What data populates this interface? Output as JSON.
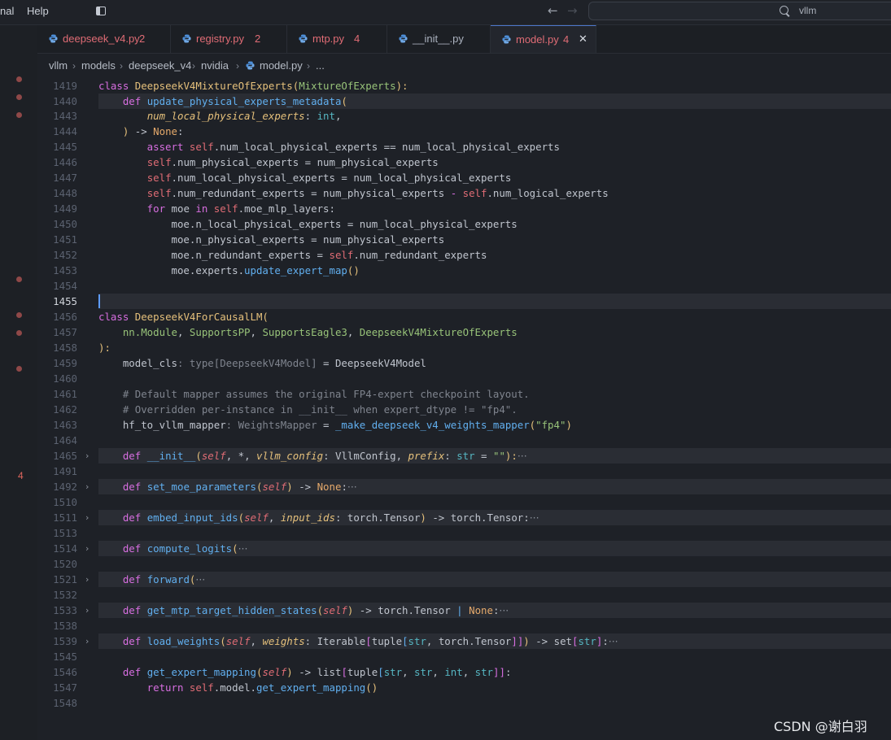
{
  "titlebar": {
    "menu": [
      "nal",
      "Help"
    ],
    "search_text": "vllm"
  },
  "tabs": [
    {
      "label": "deepseek_v4.py",
      "badge": "2",
      "color": "#e06c75"
    },
    {
      "label": "registry.py",
      "badge": "2",
      "color": "#e06c75"
    },
    {
      "label": "mtp.py",
      "badge": "4",
      "color": "#e06c75"
    },
    {
      "label": "__init__.py",
      "badge": "",
      "color": "#abb2bf"
    },
    {
      "label": "model.py",
      "badge": "4",
      "color": "#e06c75",
      "active": true
    }
  ],
  "breadcrumb": [
    "vllm",
    "models",
    "deepseek_v4",
    "nvidia",
    "model.py",
    "..."
  ],
  "editor": {
    "gutter_badge": "4",
    "line_numbers": [
      "1419",
      "1440",
      "1443",
      "1444",
      "1445",
      "1446",
      "1447",
      "1448",
      "1449",
      "1450",
      "1451",
      "1452",
      "1453",
      "1454",
      "1455",
      "1456",
      "1457",
      "1458",
      "1459",
      "1460",
      "1461",
      "1462",
      "1463",
      "1464",
      "1465",
      "1491",
      "1492",
      "1510",
      "1511",
      "1513",
      "1514",
      "1520",
      "1521",
      "1532",
      "1533",
      "1538",
      "1539",
      "1545",
      "1546",
      "1547",
      "1548"
    ],
    "current_line": "1455"
  },
  "code": {
    "l1419": [
      "class ",
      "DeepseekV4MixtureOfExperts",
      "(",
      "MixtureOfExperts",
      "):"
    ],
    "l1440": [
      "    def ",
      "update_physical_experts_metadata",
      "("
    ],
    "l1443": [
      "        ",
      "num_local_physical_experts",
      ": ",
      "int",
      ","
    ],
    "l1444": [
      "    ",
      ")",
      " -> ",
      "None",
      ":"
    ],
    "l1445": [
      "        assert ",
      "self",
      ".num_local_physical_experts == num_local_physical_experts"
    ],
    "l1446": [
      "        ",
      "self",
      ".num_physical_experts = num_physical_experts"
    ],
    "l1447": [
      "        ",
      "self",
      ".num_local_physical_experts = num_local_physical_experts"
    ],
    "l1448": [
      "        ",
      "self",
      ".num_redundant_experts = num_physical_experts ",
      "-",
      " ",
      "self",
      ".num_logical_experts"
    ],
    "l1449": [
      "        for ",
      "moe ",
      "in ",
      "self",
      ".moe_mlp_layers:"
    ],
    "l1450": [
      "            moe.n_local_physical_experts = num_local_physical_experts"
    ],
    "l1451": [
      "            moe.n_physical_experts = num_physical_experts"
    ],
    "l1452": [
      "            moe.n_redundant_experts = ",
      "self",
      ".num_redundant_experts"
    ],
    "l1453": [
      "            moe.experts.",
      "update_expert_map",
      "()"
    ],
    "l1456": [
      "class ",
      "DeepseekV4ForCausalLM",
      "("
    ],
    "l1457": [
      "    nn.",
      "Module",
      ", ",
      "SupportsPP",
      ", ",
      "SupportsEagle3",
      ", ",
      "DeepseekV4MixtureOfExperts"
    ],
    "l1458": [
      "):"
    ],
    "l1459": [
      "    model_cls",
      ": ",
      "type",
      "[",
      "DeepseekV4Model",
      "]",
      " = DeepseekV4Model"
    ],
    "l1461": [
      "    # Default mapper assumes the original FP4-expert checkpoint layout."
    ],
    "l1462": [
      "    # Overridden per-instance in __init__ when expert_dtype != \"fp4\"."
    ],
    "l1463": [
      "    hf_to_vllm_mapper",
      ": ",
      "WeightsMapper",
      " = ",
      "_make_deepseek_v4_weights_mapper",
      "(",
      "\"fp4\"",
      ")"
    ],
    "l1465": [
      "    def ",
      "__init__",
      "(",
      "self",
      ", *, ",
      "vllm_config",
      ": ",
      "VllmConfig",
      ", ",
      "prefix",
      ": ",
      "str",
      " = ",
      "\"\"",
      "):",
      "···"
    ],
    "l1492": [
      "    def ",
      "set_moe_parameters",
      "(",
      "self",
      ")",
      " -> ",
      "None",
      ":",
      "···"
    ],
    "l1511": [
      "    def ",
      "embed_input_ids",
      "(",
      "self",
      ", ",
      "input_ids",
      ": ",
      "torch.Tensor",
      ")",
      " -> ",
      "torch.Tensor",
      ":",
      "···"
    ],
    "l1514": [
      "    def ",
      "compute_logits",
      "(",
      "···"
    ],
    "l1521": [
      "    def ",
      "forward",
      "(",
      "···"
    ],
    "l1533": [
      "    def ",
      "get_mtp_target_hidden_states",
      "(",
      "self",
      ")",
      " -> ",
      "torch.Tensor",
      " | ",
      "None",
      ":",
      "···"
    ],
    "l1539": [
      "    def ",
      "load_weights",
      "(",
      "self",
      ", ",
      "weights",
      ": ",
      "Iterable",
      "[",
      "tuple",
      "[",
      "str",
      ", ",
      "torch.Tensor",
      "]]",
      ")",
      " -> ",
      "set",
      "[",
      "str",
      "]",
      ":",
      "···"
    ],
    "l1546": [
      "    def ",
      "get_expert_mapping",
      "(",
      "self",
      ")",
      " -> ",
      "list",
      "[",
      "tuple",
      "[",
      "str",
      ", ",
      "str",
      ", ",
      "int",
      ", ",
      "str",
      "]]",
      ":"
    ],
    "l1547": [
      "        return ",
      "self",
      ".model.",
      "get_expert_mapping",
      "()"
    ]
  },
  "watermark": "CSDN @谢白羽",
  "colors": {
    "background": "#1e2127",
    "keyword": "#d76ee0",
    "function": "#61afef",
    "class": "#e5c07b",
    "param": "#e06c75",
    "string": "#98c379",
    "comment": "#7f848e",
    "error_badge": "#e06c75"
  }
}
